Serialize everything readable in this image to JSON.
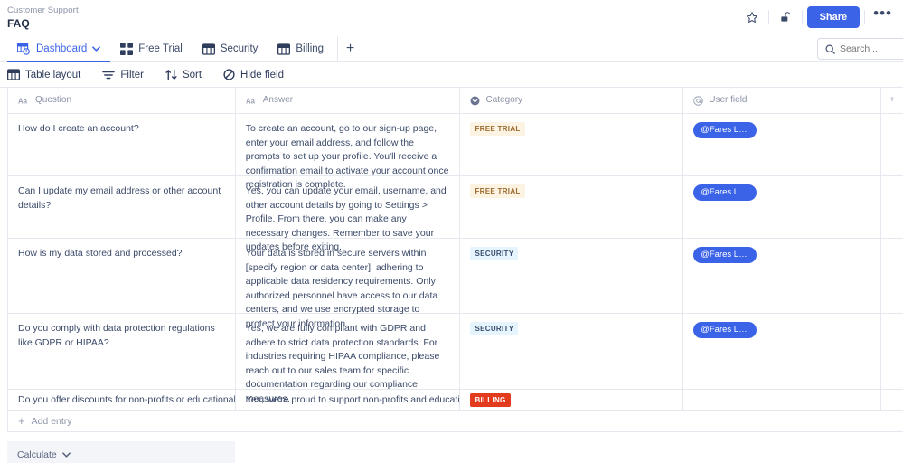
{
  "header": {
    "breadcrumb": "Customer Support",
    "title": "FAQ",
    "star_icon": "star-icon",
    "lock_icon": "lock-open-icon",
    "share_label": "Share",
    "more_label": "•••"
  },
  "tabs": [
    {
      "label": "Dashboard",
      "icon": "grid-clock-icon",
      "active": true,
      "has_chevron": true
    },
    {
      "label": "Free Trial",
      "icon": "blocks-icon",
      "active": false,
      "has_chevron": false
    },
    {
      "label": "Security",
      "icon": "grid-icon",
      "active": false,
      "has_chevron": false
    },
    {
      "label": "Billing",
      "icon": "grid-icon",
      "active": false,
      "has_chevron": false
    }
  ],
  "add_tab_label": "+",
  "search": {
    "placeholder": "Search ...",
    "value": "",
    "icon": "search-icon"
  },
  "toolbar": [
    {
      "label": "Table layout",
      "icon": "table-icon"
    },
    {
      "label": "Filter",
      "icon": "filter-icon"
    },
    {
      "label": "Sort",
      "icon": "sort-icon"
    },
    {
      "label": "Hide field",
      "icon": "hide-field-icon"
    }
  ],
  "table": {
    "columns": [
      {
        "label": "Question",
        "icon": "text-field-icon"
      },
      {
        "label": "Answer",
        "icon": "text-field-icon"
      },
      {
        "label": "Category",
        "icon": "select-field-icon"
      },
      {
        "label": "User field",
        "icon": "at-mention-icon"
      }
    ],
    "add_column_label": "+",
    "rows": [
      {
        "question": "How do I create an account?",
        "answer": "To create an account, go to our sign-up page, enter your email address, and follow the prompts to set up your profile. You'll receive a confirmation email to activate your account once registration is complete.",
        "category": "FREE TRIAL",
        "category_style": "b-free",
        "user": "@Fares Lar..."
      },
      {
        "question": "Can I update my email address or other account details?",
        "answer": "Yes, you can update your email, username, and other account details by going to Settings > Profile. From there, you can make any necessary changes. Remember to save your updates before exiting.",
        "category": "FREE TRIAL",
        "category_style": "b-free",
        "user": "@Fares Lar..."
      },
      {
        "question": "How is my data stored and processed?",
        "answer": "Your data is stored in secure servers within [specify region or data center], adhering to applicable data residency requirements. Only authorized personnel have access to our data centers, and we use encrypted storage to protect your information.",
        "category": "SECURITY",
        "category_style": "b-sec",
        "user": "@Fares Lar..."
      },
      {
        "question": "Do you comply with data protection regulations like GDPR or HIPAA?",
        "answer": "Yes, we are fully compliant with GDPR and adhere to strict data protection standards. For industries requiring HIPAA compliance, please reach out to our sales team for specific documentation regarding our compliance measures.",
        "category": "SECURITY",
        "category_style": "b-sec",
        "user": "@Fares Lar..."
      },
      {
        "question": "Do you offer discounts for non-profits or educational",
        "answer": "Yes, we're proud to support non-profits and educational",
        "category": "BILLING",
        "category_style": "b-bill",
        "user": ""
      }
    ]
  },
  "footer": {
    "add_entry_label": "Add entry",
    "calculate_label": "Calculate"
  },
  "colors": {
    "accent": "#3b63e8",
    "text": "#3b4a69",
    "muted": "#8b93a7",
    "border": "#e6e8ef",
    "badge_free_bg": "#fdf3e2",
    "badge_free_fg": "#9c6b2f",
    "badge_security_bg": "#e6f4fd",
    "badge_security_fg": "#3b5070",
    "badge_billing_bg": "#e33b1e",
    "badge_billing_fg": "#ffffff"
  }
}
